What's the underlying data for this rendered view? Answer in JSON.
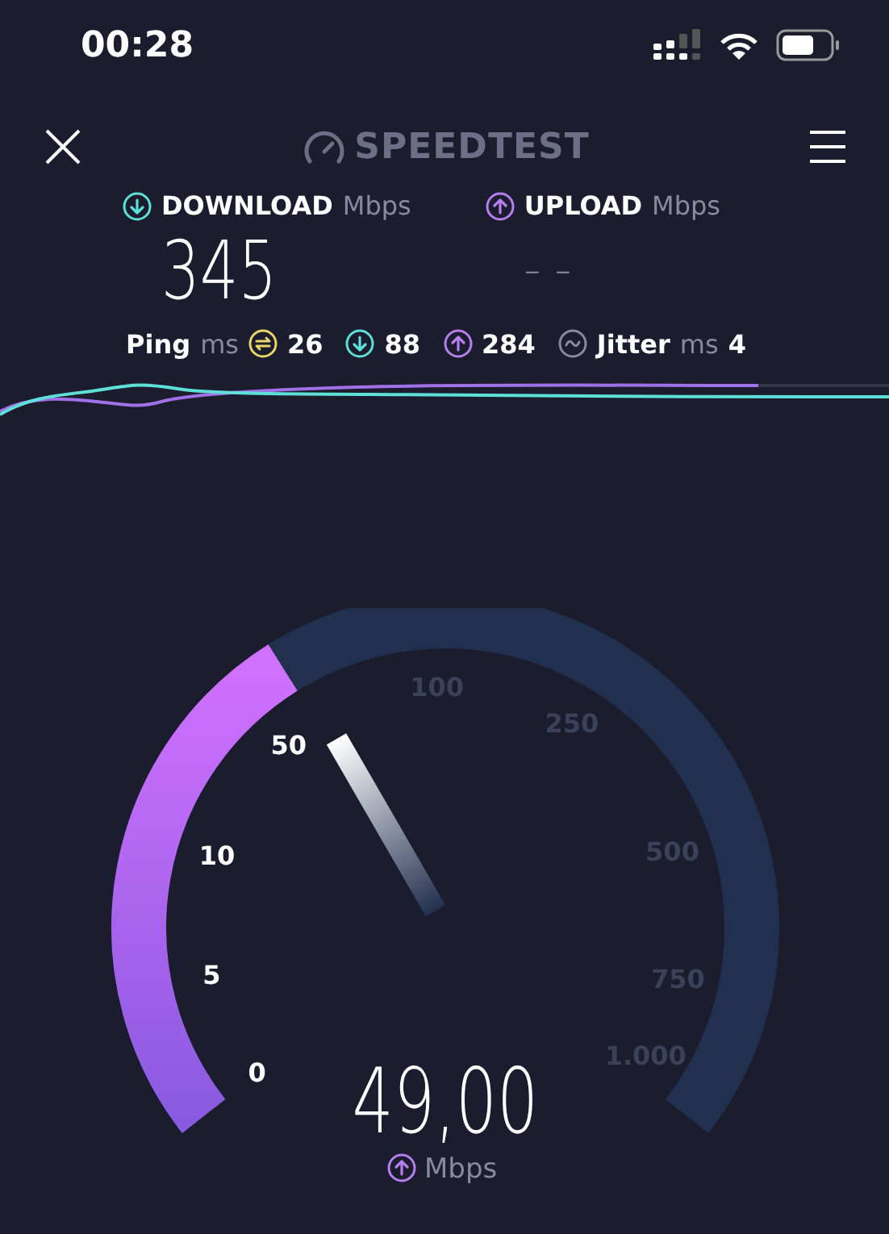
{
  "status_bar": {
    "time": "00:28"
  },
  "header": {
    "logo": "SPEEDTEST"
  },
  "download": {
    "label": "DOWNLOAD",
    "unit": "Mbps",
    "value": "345"
  },
  "upload": {
    "label": "UPLOAD",
    "unit": "Mbps",
    "value": "– –"
  },
  "ping": {
    "label": "Ping",
    "unit": "ms",
    "idle": "26",
    "download": "88",
    "upload": "284"
  },
  "jitter": {
    "label": "Jitter",
    "unit": "ms",
    "value": "4"
  },
  "gauge": {
    "value": "49,00",
    "unit": "Mbps",
    "ticks": [
      {
        "label": "0",
        "active": true
      },
      {
        "label": "5",
        "active": true
      },
      {
        "label": "10",
        "active": true
      },
      {
        "label": "50",
        "active": true
      },
      {
        "label": "100",
        "active": false
      },
      {
        "label": "250",
        "active": false
      },
      {
        "label": "500",
        "active": false
      },
      {
        "label": "750",
        "active": false
      },
      {
        "label": "1.000",
        "active": false
      }
    ]
  }
}
